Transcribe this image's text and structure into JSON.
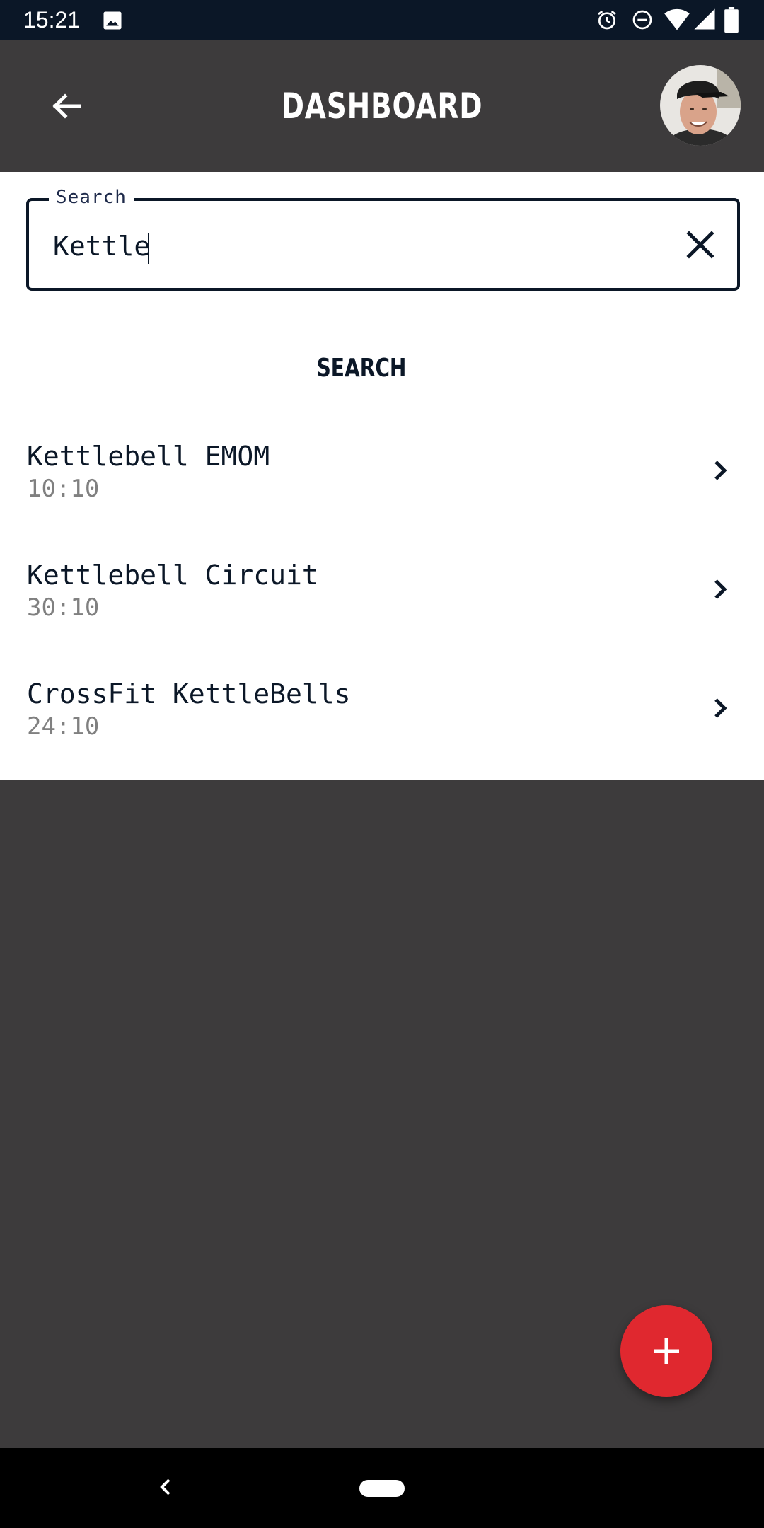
{
  "status_bar": {
    "time": "15:21",
    "icons": [
      "image-icon",
      "alarm-icon",
      "do-not-disturb-icon",
      "wifi-icon",
      "signal-icon",
      "battery-icon"
    ]
  },
  "app_bar": {
    "title": "DASHBOARD",
    "back_icon": "arrow-back-icon",
    "avatar": "user-avatar"
  },
  "search": {
    "label": "Search",
    "value": "Kettle",
    "clear_icon": "close-icon"
  },
  "section_title": "SEARCH",
  "results": [
    {
      "title": "Kettlebell EMOM",
      "time": "10:10"
    },
    {
      "title": "Kettlebell Circuit",
      "time": "30:10"
    },
    {
      "title": "CrossFit KettleBells",
      "time": "24:10"
    }
  ],
  "fab": {
    "icon": "plus-icon"
  },
  "nav_bar": {
    "back_icon": "nav-back-icon",
    "home_icon": "nav-home-pill"
  },
  "colors": {
    "status_bar": "#0b1727",
    "app_bar": "#3d3b3c",
    "accent": "#e0282f",
    "text_primary": "#0b1727",
    "text_secondary": "#808080"
  }
}
